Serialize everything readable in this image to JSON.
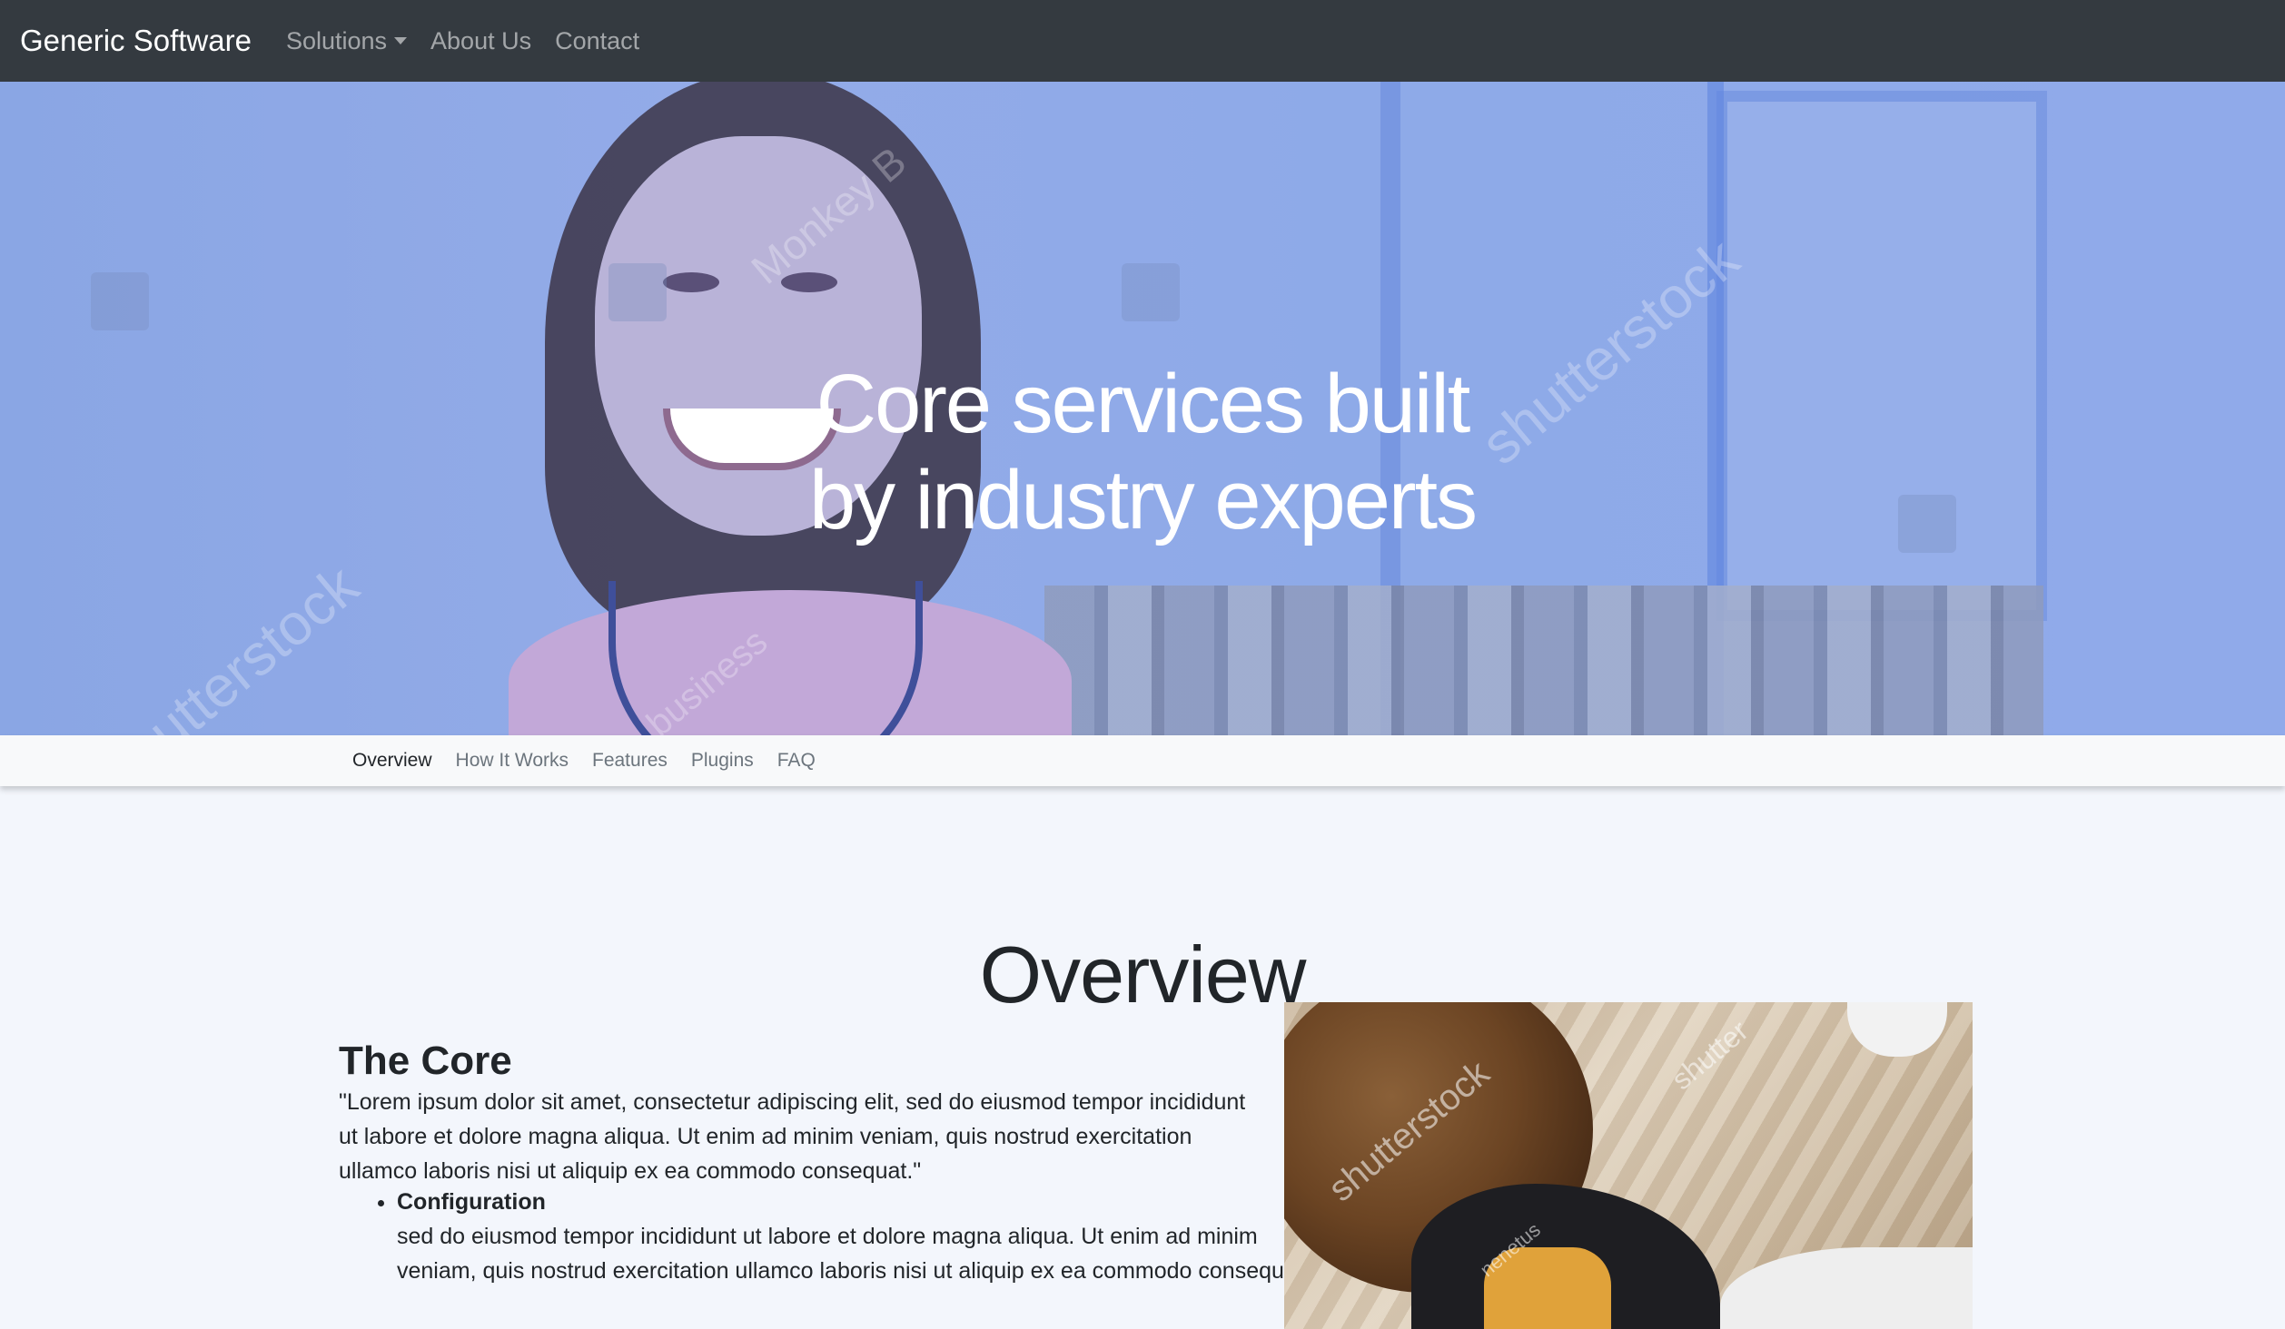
{
  "navbar": {
    "brand": "Generic Software",
    "links": [
      {
        "label": "Solutions",
        "has_dropdown": true
      },
      {
        "label": "About Us"
      },
      {
        "label": "Contact"
      }
    ]
  },
  "hero": {
    "title_line1": "Core services built",
    "title_line2": "by industry experts",
    "watermarks": [
      "shutterstock",
      "Monkey B",
      "shutterstock",
      "business"
    ]
  },
  "subnav": {
    "items": [
      "Overview",
      "How It Works",
      "Features",
      "Plugins",
      "FAQ"
    ],
    "active": "Overview"
  },
  "overview": {
    "title": "Overview",
    "heading": "The Core",
    "paragraph": "\"Lorem ipsum dolor sit amet, consectetur adipiscing elit, sed do eiusmod tempor incididunt ut labore et dolore magna aliqua. Ut enim ad minim veniam, quis nostrud exercitation ullamco laboris nisi ut aliquip ex ea commodo consequat.\"",
    "list": [
      {
        "title": "Configuration",
        "text": "sed do eiusmod tempor incididunt ut labore et dolore magna aliqua. Ut enim ad minim veniam, quis nostrud exercitation ullamco laboris nisi ut aliquip ex ea commodo consequat."
      }
    ],
    "side_photo_watermarks": [
      "shutterstock",
      "shutter",
      "nenetus"
    ]
  },
  "colors": {
    "navbar_bg": "#343a40",
    "hero_overlay": "#8eaae8",
    "page_bg": "#f3f6fc"
  }
}
